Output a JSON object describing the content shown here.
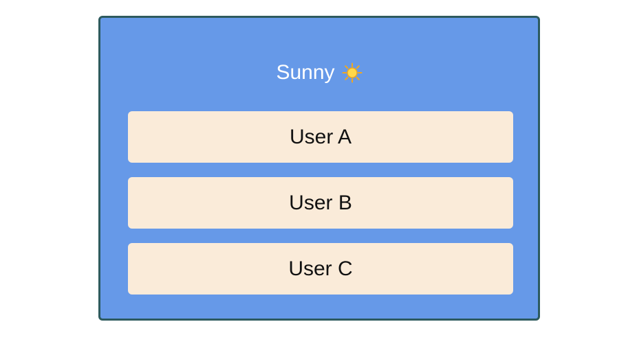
{
  "weather": {
    "label": "Sunny",
    "icon": "sun-icon"
  },
  "users": [
    {
      "label": "User A"
    },
    {
      "label": "User B"
    },
    {
      "label": "User C"
    }
  ],
  "colors": {
    "card_background": "#6699e8",
    "card_border": "#2d5a5e",
    "item_background": "#faebd9",
    "weather_text": "#ffffff"
  }
}
